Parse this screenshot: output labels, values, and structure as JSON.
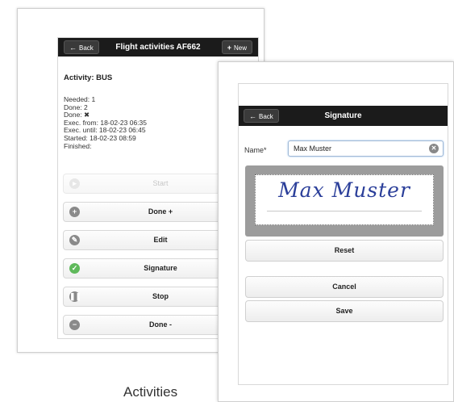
{
  "screen1": {
    "back_label": "Back",
    "title": "Flight activities AF662",
    "new_label": "New",
    "activity_title": "Activity: BUS",
    "info": {
      "needed": "Needed: 1",
      "done": "Done: 2",
      "done_flag": "Done: ✖",
      "exec_from": "Exec. from: 18-02-23 06:35",
      "exec_until": "Exec. until: 18-02-23 06:45",
      "started": "Started: 18-02-23 08:59",
      "finished": "Finished:"
    },
    "actions": [
      {
        "label": "Start",
        "icon": "play-icon",
        "enabled": false
      },
      {
        "label": "Done +",
        "icon": "plus-icon",
        "enabled": true
      },
      {
        "label": "Edit",
        "icon": "pencil-icon",
        "enabled": true
      },
      {
        "label": "Signature",
        "icon": "signature-icon",
        "enabled": true
      },
      {
        "label": "Stop",
        "icon": "pause-icon",
        "enabled": true
      },
      {
        "label": "Done -",
        "icon": "minus-icon",
        "enabled": true
      }
    ]
  },
  "screen2": {
    "back_label": "Back",
    "title": "Signature",
    "name_label": "Name*",
    "name_value": "Max Muster",
    "signature_text": "Max Muster",
    "reset_label": "Reset",
    "cancel_label": "Cancel",
    "save_label": "Save"
  },
  "caption": "Activities",
  "colors": {
    "topbar": "#1b1b1b",
    "signature_ink": "#2b3f9a",
    "signature_pad": "#9c9c9c",
    "signature_icon": "#5fb95b"
  }
}
